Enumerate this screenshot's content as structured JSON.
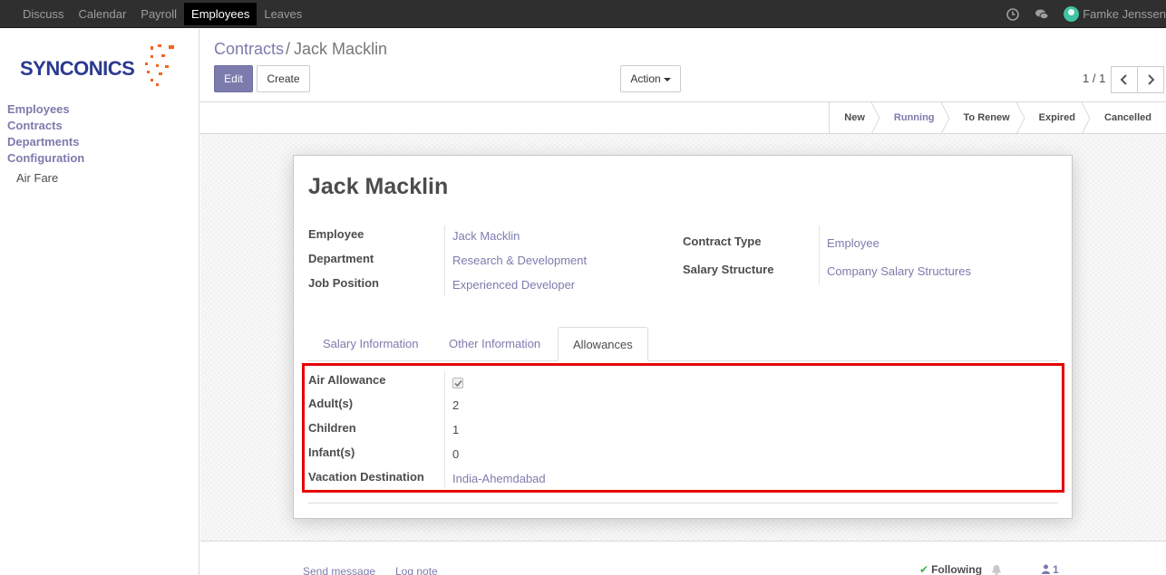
{
  "topbar": {
    "menu": [
      "Discuss",
      "Calendar",
      "Payroll",
      "Employees",
      "Leaves"
    ],
    "active": "Employees",
    "user": "Famke Jenssen"
  },
  "sidebar": {
    "logo_text": "SYNCONICS",
    "items": [
      "Employees",
      "Contracts",
      "Departments",
      "Configuration"
    ],
    "subitems": [
      "Air Fare"
    ]
  },
  "breadcrumb": {
    "parent": "Contracts",
    "separator": "/",
    "current": "Jack Macklin"
  },
  "buttons": {
    "edit": "Edit",
    "create": "Create",
    "action": "Action"
  },
  "pager": {
    "value": "1 / 1"
  },
  "stages": [
    "New",
    "Running",
    "To Renew",
    "Expired",
    "Cancelled"
  ],
  "current_stage": "Running",
  "contract": {
    "title": "Jack Macklin",
    "left_fields": [
      {
        "label": "Employee",
        "value": "Jack Macklin"
      },
      {
        "label": "Department",
        "value": "Research & Development"
      },
      {
        "label": "Job Position",
        "value": "Experienced Developer"
      }
    ],
    "right_fields": [
      {
        "label": "Contract Type",
        "value": "Employee"
      },
      {
        "label": "Salary Structure",
        "value": "Company Salary Structures"
      }
    ]
  },
  "tabs": [
    "Salary Information",
    "Other Information",
    "Allowances"
  ],
  "active_tab": "Allowances",
  "allowances": {
    "air_allowance_label": "Air Allowance",
    "air_allowance_checked": true,
    "adults_label": "Adult(s)",
    "adults": "2",
    "children_label": "Children",
    "children": "1",
    "infants_label": "Infant(s)",
    "infants": "0",
    "destination_label": "Vacation Destination",
    "destination": "India-Ahemdabad"
  },
  "chatter": {
    "send_message": "Send message",
    "log_note": "Log note",
    "following": "Following",
    "followers_count": "1"
  },
  "colors": {
    "primary": "#7c7bad",
    "highlight": "#e60000",
    "topbar": "#2f2f2f"
  }
}
